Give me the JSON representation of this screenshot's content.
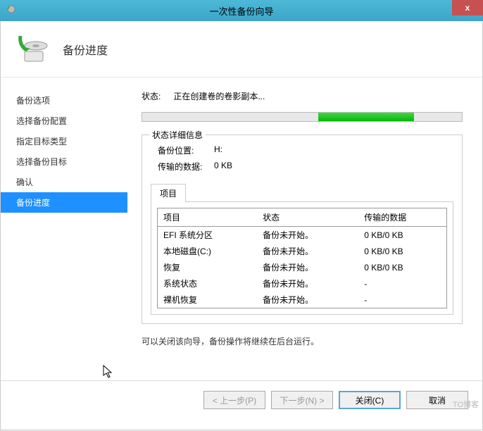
{
  "window": {
    "title": "一次性备份向导",
    "close_label": "x"
  },
  "header": {
    "title": "备份进度"
  },
  "sidebar": {
    "items": [
      {
        "label": "备份选项"
      },
      {
        "label": "选择备份配置"
      },
      {
        "label": "指定目标类型"
      },
      {
        "label": "选择备份目标"
      },
      {
        "label": "确认"
      },
      {
        "label": "备份进度"
      }
    ]
  },
  "main": {
    "status_label": "状态:",
    "status_value": "正在创建卷的卷影副本...",
    "details_legend": "状态详细信息",
    "location_label": "备份位置:",
    "location_value": "H:",
    "transferred_label": "传输的数据:",
    "transferred_value": "0 KB",
    "tab_label": "项目",
    "table": {
      "headers": {
        "item": "项目",
        "status": "状态",
        "data": "传输的数据"
      },
      "rows": [
        {
          "item": "EFI 系统分区",
          "status": "备份未开始。",
          "data": "0 KB/0 KB"
        },
        {
          "item": "本地磁盘(C:)",
          "status": "备份未开始。",
          "data": "0 KB/0 KB"
        },
        {
          "item": "恢复",
          "status": "备份未开始。",
          "data": "0 KB/0 KB"
        },
        {
          "item": "系统状态",
          "status": "备份未开始。",
          "data": "-"
        },
        {
          "item": "裸机恢复",
          "status": "备份未开始。",
          "data": "-"
        }
      ]
    },
    "note": "可以关闭该向导，备份操作将继续在后台运行。"
  },
  "footer": {
    "prev": "< 上一步(P)",
    "next": "下一步(N) >",
    "close": "关闭(C)",
    "cancel": "取消"
  },
  "watermark": "TO博客"
}
